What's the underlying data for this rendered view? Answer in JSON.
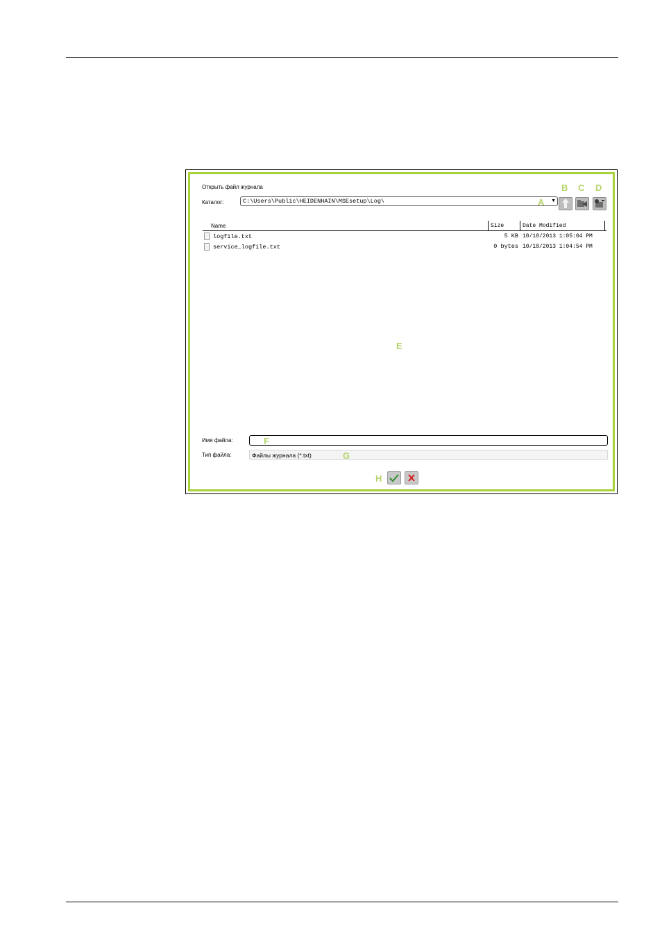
{
  "dialog": {
    "title": "Открыть файл журнала",
    "directory_label": "Каталог:",
    "directory_value": "C:\\Users\\Public\\HEIDENHAIN\\MSEsetup\\Log\\",
    "columns": [
      "Name",
      "Size",
      "Date Modified"
    ],
    "files": [
      {
        "name": "logfile.txt",
        "size": "5 KB",
        "date": "10/18/2013 1:05:04 PM"
      },
      {
        "name": "service_logfile.txt",
        "size": "0 bytes",
        "date": "10/18/2013 1:04:54 PM"
      }
    ],
    "filename_label": "Имя файла:",
    "filename_value": "",
    "filetype_label": "Тип файла:",
    "filetype_value": "Файлы журнала (*.txt)"
  },
  "callouts": {
    "a": "A",
    "b": "B",
    "c": "C",
    "d": "D",
    "e": "E",
    "f": "F",
    "g": "G",
    "h": "H"
  },
  "icons": {
    "up": "arrow-up-icon",
    "folder_back": "folder-back-icon",
    "folder_new": "new-folder-icon",
    "ok": "checkmark-icon",
    "cancel": "close-icon"
  },
  "colors": {
    "frame": "#a9d13a",
    "callout": "#b6d46c",
    "ok": "#2e8b2e",
    "cancel": "#d41f1f"
  }
}
